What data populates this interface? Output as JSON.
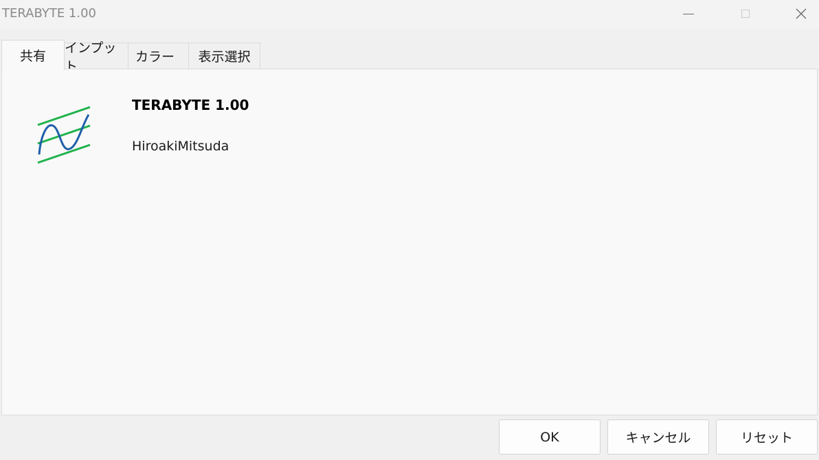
{
  "window": {
    "title": "TERABYTE 1.00",
    "minimize_icon": "minimize-icon",
    "maximize_icon": "maximize-icon",
    "close_icon": "close-icon",
    "close_glyph": "✕"
  },
  "tabs": [
    {
      "label": "共有",
      "active": true
    },
    {
      "label": "インプット",
      "active": false
    },
    {
      "label": "カラー",
      "active": false
    },
    {
      "label": "表示選択",
      "active": false
    }
  ],
  "common": {
    "indicator_name": "TERABYTE 1.00",
    "author": "HiroakiMitsuda",
    "logo_icon": "indicator-wave-channel-icon",
    "colors": {
      "channel_lines": "#1fb24a",
      "wave": "#1f5faa"
    }
  },
  "buttons": {
    "ok": "OK",
    "cancel": "キャンセル",
    "reset": "リセット"
  }
}
